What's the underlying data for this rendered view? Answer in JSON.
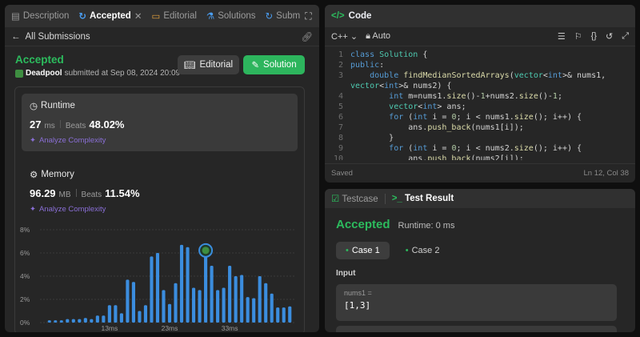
{
  "left_tabs": [
    {
      "label": "Description",
      "icon": "description-icon"
    },
    {
      "label": "Accepted",
      "icon": "history-icon"
    },
    {
      "label": "Editorial",
      "icon": "book-icon"
    },
    {
      "label": "Solutions",
      "icon": "flask-icon"
    },
    {
      "label": "Subm",
      "icon": "history-icon"
    }
  ],
  "subheader": {
    "back_label": "All Submissions"
  },
  "submission": {
    "status": "Accepted",
    "user": "Deadpool",
    "submitted_text": "submitted at Sep 08, 2024 20:09",
    "editorial_label": "Editorial",
    "solution_label": "Solution"
  },
  "runtime": {
    "title": "Runtime",
    "value": "27",
    "unit": "ms",
    "beats_label": "Beats",
    "beats": "48.02%",
    "analyze": "Analyze Complexity"
  },
  "memory": {
    "title": "Memory",
    "value": "96.29",
    "unit": "MB",
    "beats_label": "Beats",
    "beats": "11.54%",
    "analyze": "Analyze Complexity"
  },
  "chart_data": {
    "type": "bar",
    "y_ticks": [
      "8%",
      "6%",
      "4%",
      "2%",
      "0%"
    ],
    "ylim": [
      0,
      8
    ],
    "x_ticks": [
      {
        "label": "13ms",
        "index": 10
      },
      {
        "label": "23ms",
        "index": 20
      },
      {
        "label": "33ms",
        "index": 30
      }
    ],
    "values": [
      0.2,
      0.2,
      0.2,
      0.3,
      0.3,
      0.3,
      0.4,
      0.3,
      0.6,
      0.6,
      1.5,
      1.5,
      0.8,
      3.7,
      3.5,
      1.0,
      1.5,
      5.7,
      6.0,
      2.8,
      1.6,
      3.4,
      6.7,
      6.5,
      3.0,
      2.8,
      6.7,
      4.9,
      2.8,
      3.0,
      4.9,
      4.0,
      4.1,
      2.2,
      2.1,
      4.0,
      3.4,
      2.5,
      1.3,
      1.3,
      1.4
    ],
    "highlight_index": 26,
    "bar_color": "#3b8dde"
  },
  "code_panel": {
    "title": "Code",
    "language": "C++",
    "mode": "Auto",
    "footer_left": "Saved",
    "footer_right": "Ln 12, Col 38"
  },
  "code_lines": [
    {
      "n": "1",
      "t": "class Solution {"
    },
    {
      "n": "2",
      "t": "public:"
    },
    {
      "n": "3",
      "t": "    double findMedianSortedArrays(vector<int>& nums1,"
    },
    {
      "n": "",
      "t": "vector<int>& nums2) {"
    },
    {
      "n": "4",
      "t": "        int m=nums1.size()-1+nums2.size()-1;"
    },
    {
      "n": "5",
      "t": "        vector<int> ans;"
    },
    {
      "n": "6",
      "t": "        for (int i = 0; i < nums1.size(); i++) {"
    },
    {
      "n": "7",
      "t": "            ans.push_back(nums1[i]);"
    },
    {
      "n": "8",
      "t": "        }"
    },
    {
      "n": "9",
      "t": "        for (int i = 0; i < nums2.size(); i++) {"
    },
    {
      "n": "10",
      "t": "            ans.push_back(nums2[i]);"
    }
  ],
  "result_panel": {
    "testcase_label": "Testcase",
    "result_label": "Test Result",
    "status": "Accepted",
    "runtime": "Runtime: 0 ms",
    "cases": [
      "Case 1",
      "Case 2"
    ],
    "input_label": "Input",
    "input_name": "nums1 =",
    "input_value": "[1,3]"
  }
}
